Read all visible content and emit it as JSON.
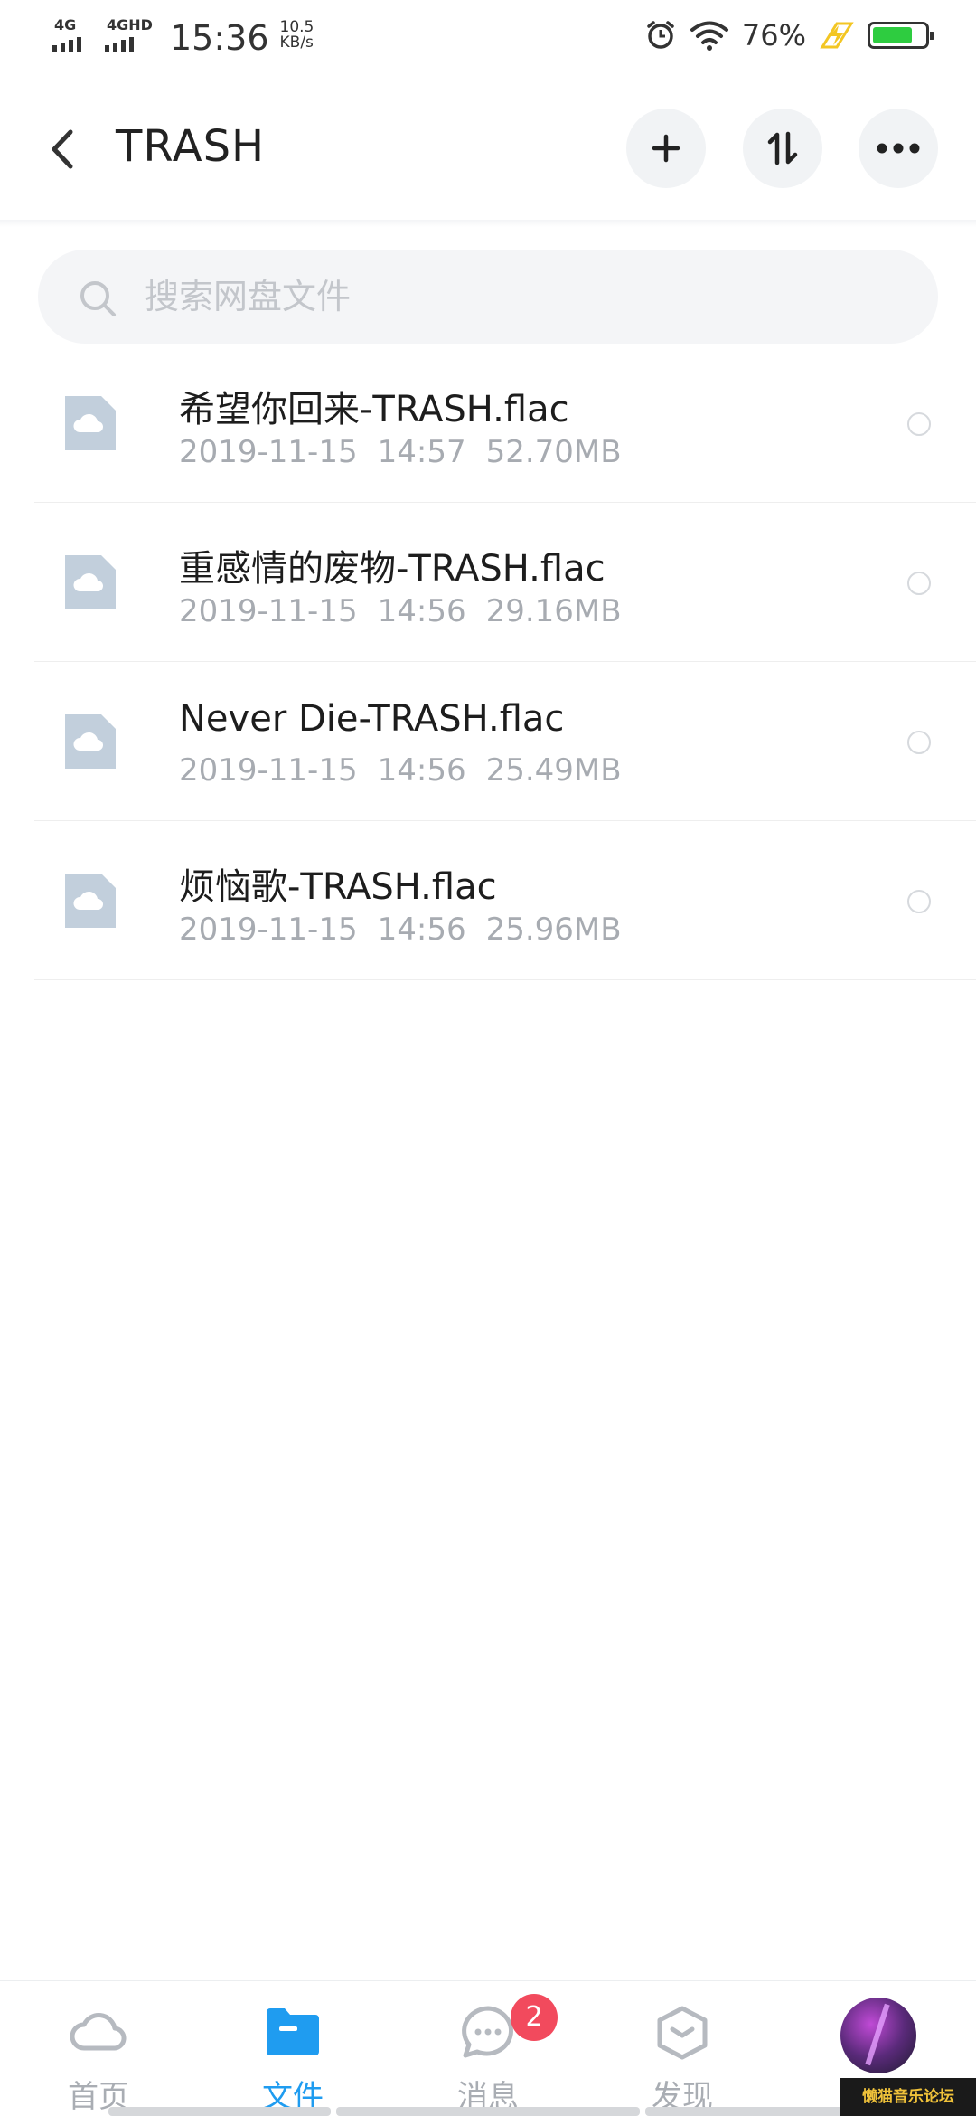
{
  "status_bar": {
    "net1": "4G",
    "net2": "4GHD",
    "time": "15:36",
    "speed_value": "10.5",
    "speed_unit": "KB/s",
    "battery_pct": "76%",
    "battery_level": 0.76,
    "icons": [
      "alarm-icon",
      "wifi-icon",
      "charging-icon",
      "battery-icon"
    ]
  },
  "header": {
    "title": "TRASH",
    "back_icon": "chevron-left-icon",
    "actions": [
      "plus-icon",
      "sort-icon",
      "more-icon"
    ]
  },
  "search": {
    "placeholder": "搜索网盘文件",
    "value": ""
  },
  "files": [
    {
      "name": "希望你回来-TRASH.flac",
      "date": "2019-11-15",
      "time": "14:57",
      "size": "52.70MB"
    },
    {
      "name": "重感情的废物-TRASH.flac",
      "date": "2019-11-15",
      "time": "14:56",
      "size": "29.16MB"
    },
    {
      "name": "Never Die-TRASH.flac",
      "date": "2019-11-15",
      "time": "14:56",
      "size": "25.49MB"
    },
    {
      "name": "烦恼歌-TRASH.flac",
      "date": "2019-11-15",
      "time": "14:56",
      "size": "25.96MB"
    }
  ],
  "nav": {
    "items": [
      {
        "label": "首页",
        "icon": "cloud-icon"
      },
      {
        "label": "文件",
        "icon": "folder-icon",
        "active": true
      },
      {
        "label": "消息",
        "icon": "chat-icon",
        "badge": "2"
      },
      {
        "label": "发现",
        "icon": "discover-icon"
      }
    ],
    "accent": "#1f9cf0",
    "badge_color": "#f24a5d"
  },
  "watermark": "懒猫音乐论坛"
}
